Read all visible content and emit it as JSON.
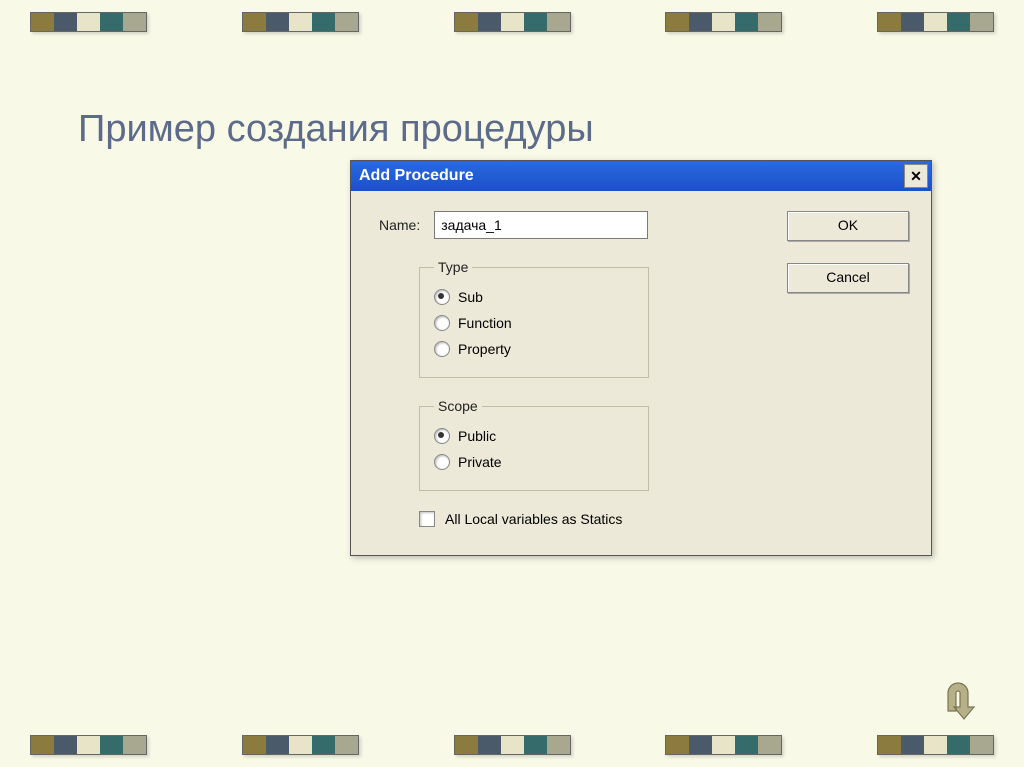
{
  "slide": {
    "title": "Пример создания процедуры"
  },
  "dialog": {
    "title": "Add Procedure",
    "name_label": "Name:",
    "name_value": "задача_1",
    "buttons": {
      "ok": "OK",
      "cancel": "Cancel"
    },
    "type": {
      "legend": "Type",
      "options": {
        "sub": "Sub",
        "function": "Function",
        "property": "Property"
      },
      "selected": "sub"
    },
    "scope": {
      "legend": "Scope",
      "options": {
        "public": "Public",
        "private": "Private"
      },
      "selected": "public"
    },
    "statics_label": "All Local variables as Statics",
    "statics_checked": false
  }
}
